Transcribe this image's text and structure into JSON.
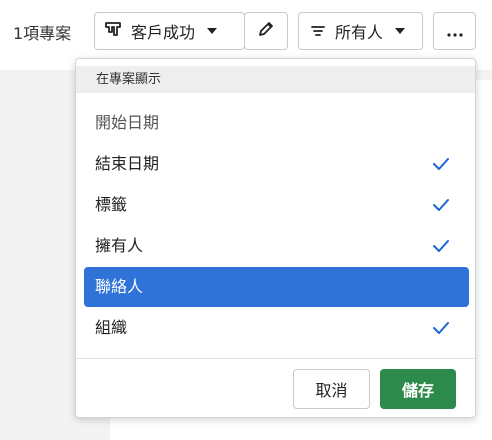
{
  "toolbar": {
    "project_count": "1項專案",
    "pipeline_label": "客戶成功",
    "owner_filter_label": "所有人",
    "more_label": "···"
  },
  "dropdown": {
    "header": "在專案顯示",
    "options": [
      {
        "label": "開始日期",
        "checked": false,
        "highlighted": false
      },
      {
        "label": "結束日期",
        "checked": true,
        "highlighted": false
      },
      {
        "label": "標籤",
        "checked": true,
        "highlighted": false
      },
      {
        "label": "擁有人",
        "checked": true,
        "highlighted": false
      },
      {
        "label": "聯絡人",
        "checked": false,
        "highlighted": true
      },
      {
        "label": "組織",
        "checked": true,
        "highlighted": false
      }
    ],
    "cancel_label": "取消",
    "save_label": "儲存"
  },
  "colors": {
    "accent": "#2f73d9",
    "check": "#1a66d6",
    "save": "#2c8a4a"
  },
  "icons": [
    "pipeline-icon",
    "pencil-icon",
    "filter-icon",
    "more-icon",
    "checkmark-icon"
  ]
}
